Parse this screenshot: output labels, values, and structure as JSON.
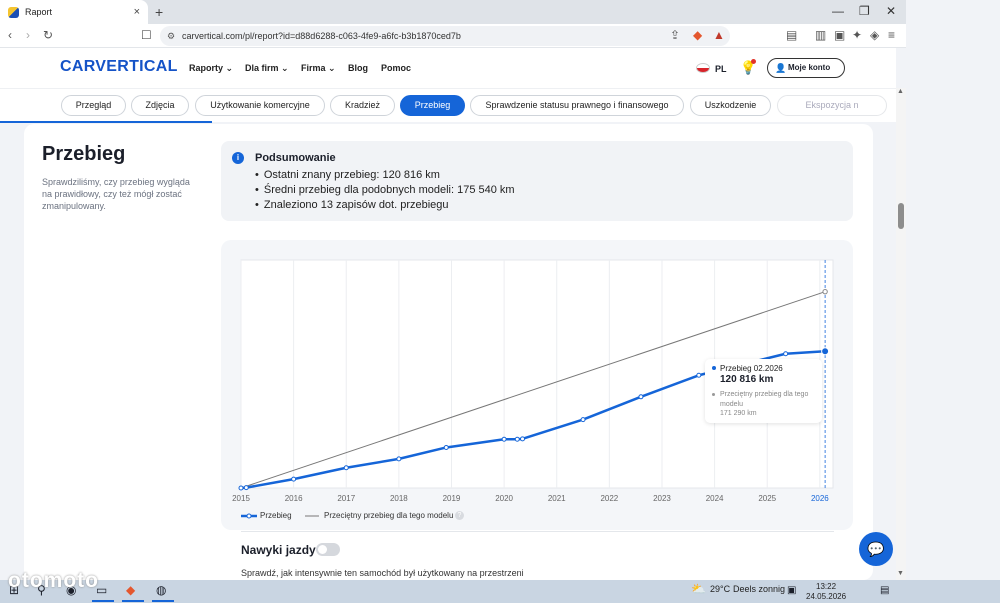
{
  "browser": {
    "tab_title": "Raport",
    "url": "carvertical.com/pl/report?id=d88d6288-c063-4fe9-a6fc-b3b1870ced7b",
    "new_tab_icon": "+",
    "close_tab_icon": "×"
  },
  "site": {
    "logo": "CARVERTICAL",
    "nav": [
      "Raporty",
      "Dla firm",
      "Firma",
      "Blog",
      "Pomoc"
    ],
    "lang": "PL",
    "account": "Moje konto"
  },
  "section_tabs": [
    {
      "label": "Przegląd"
    },
    {
      "label": "Zdjęcia"
    },
    {
      "label": "Użytkowanie komercyjne"
    },
    {
      "label": "Kradzież"
    },
    {
      "label": "Przebieg"
    },
    {
      "label": "Sprawdzenie statusu prawnego i finansowego"
    },
    {
      "label": "Uszkodzenie"
    },
    {
      "label": "Ekspozycja n"
    }
  ],
  "section": {
    "title": "Przebieg",
    "description": "Sprawdziliśmy, czy przebieg wygląda na prawidłowy, czy też mógł zostać zmanipulowany."
  },
  "summary": {
    "title": "Podsumowanie",
    "items": [
      "Ostatni znany przebieg: 120 816 km",
      "Średni przebieg dla podobnych modeli: 175 540 km",
      "Znaleziono 13 zapisów dot. przebiegu"
    ]
  },
  "tooltip": {
    "date": "Przebieg 02.2026",
    "value": "120 816 km",
    "avg_label": "Przeciętny przebieg dla tego modelu",
    "avg_value": "171 290 km"
  },
  "chart_data": {
    "type": "line",
    "x_range": [
      2015.0,
      2026.25
    ],
    "y_range": [
      0,
      180000
    ],
    "ticks": [
      "2015",
      "2016",
      "2017",
      "2018",
      "2019",
      "2020",
      "2021",
      "2022",
      "2023",
      "2024",
      "2025",
      "2026"
    ],
    "highlight_x": 2026.1,
    "series": [
      {
        "name": "Przebieg",
        "color": "#1565d8",
        "points": [
          {
            "x": 2015.0,
            "y": 0
          },
          {
            "x": 2015.1,
            "y": 300
          },
          {
            "x": 2016.0,
            "y": 7000
          },
          {
            "x": 2017.0,
            "y": 16000
          },
          {
            "x": 2018.0,
            "y": 23000
          },
          {
            "x": 2018.9,
            "y": 32000
          },
          {
            "x": 2020.0,
            "y": 38500
          },
          {
            "x": 2020.25,
            "y": 38500
          },
          {
            "x": 2020.35,
            "y": 38800
          },
          {
            "x": 2021.5,
            "y": 54000
          },
          {
            "x": 2022.6,
            "y": 72000
          },
          {
            "x": 2023.7,
            "y": 89000
          },
          {
            "x": 2025.35,
            "y": 106000
          },
          {
            "x": 2026.1,
            "y": 108000
          }
        ]
      },
      {
        "name": "Przeciętny przebieg dla tego modelu",
        "color": "#777777",
        "points": [
          {
            "x": 2015.0,
            "y": 0
          },
          {
            "x": 2026.1,
            "y": 155000
          }
        ]
      }
    ]
  },
  "legend": {
    "mileage": "Przebieg",
    "average": "Przeciętny przebieg dla tego modelu",
    "help": "?"
  },
  "driving": {
    "title": "Nawyki jazdy",
    "description": "Sprawdź, jak intensywnie ten samochód był użytkowany na przestrzeni"
  },
  "taskbar": {
    "temperature": "29°C",
    "weather": "Deels zonnig",
    "time": "13:22",
    "date": "24.05.2026",
    "watermark": "otomoto"
  },
  "colors": {
    "accent": "#1565d8"
  }
}
